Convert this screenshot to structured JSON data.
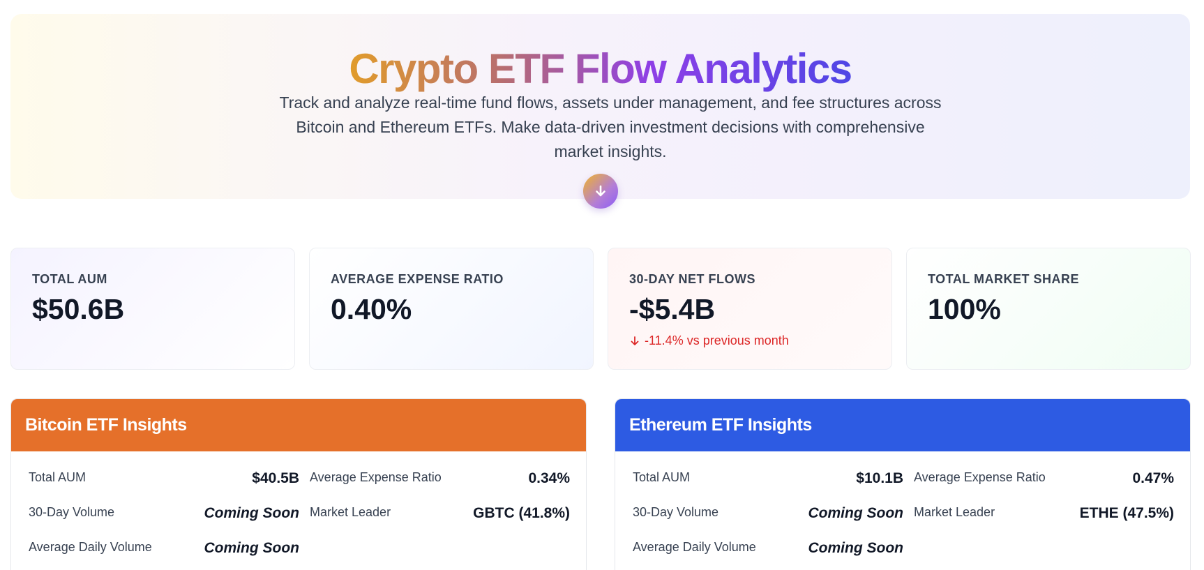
{
  "hero": {
    "title": "Crypto ETF Flow Analytics",
    "subtitle": "Track and analyze real-time fund flows, assets under management, and fee structures across Bitcoin and Ethereum ETFs. Make data-driven investment decisions with comprehensive market insights.",
    "scroll_icon": "arrow-down-icon"
  },
  "stats": [
    {
      "label": "TOTAL AUM",
      "value": "$50.6B"
    },
    {
      "label": "AVERAGE EXPENSE RATIO",
      "value": "0.40%"
    },
    {
      "label": "30-DAY NET FLOWS",
      "value": "-$5.4B",
      "change": "-11.4% vs previous month",
      "change_icon": "arrow-down-icon"
    },
    {
      "label": "TOTAL MARKET SHARE",
      "value": "100%"
    }
  ],
  "bitcoin": {
    "title": "Bitcoin ETF Insights",
    "color": "#e5702a",
    "total_aum_label": "Total AUM",
    "total_aum": "$40.5B",
    "expense_label": "Average Expense Ratio",
    "expense": "0.34%",
    "volume_label": "30-Day Volume",
    "volume": "Coming Soon",
    "leader_label": "Market Leader",
    "leader": "GBTC (41.8%)",
    "daily_label": "Average Daily Volume",
    "daily": "Coming Soon"
  },
  "ethereum": {
    "title": "Ethereum ETF Insights",
    "color": "#2d5be3",
    "total_aum_label": "Total AUM",
    "total_aum": "$10.1B",
    "expense_label": "Average Expense Ratio",
    "expense": "0.47%",
    "volume_label": "30-Day Volume",
    "volume": "Coming Soon",
    "leader_label": "Market Leader",
    "leader": "ETHE (47.5%)",
    "daily_label": "Average Daily Volume",
    "daily": "Coming Soon"
  }
}
